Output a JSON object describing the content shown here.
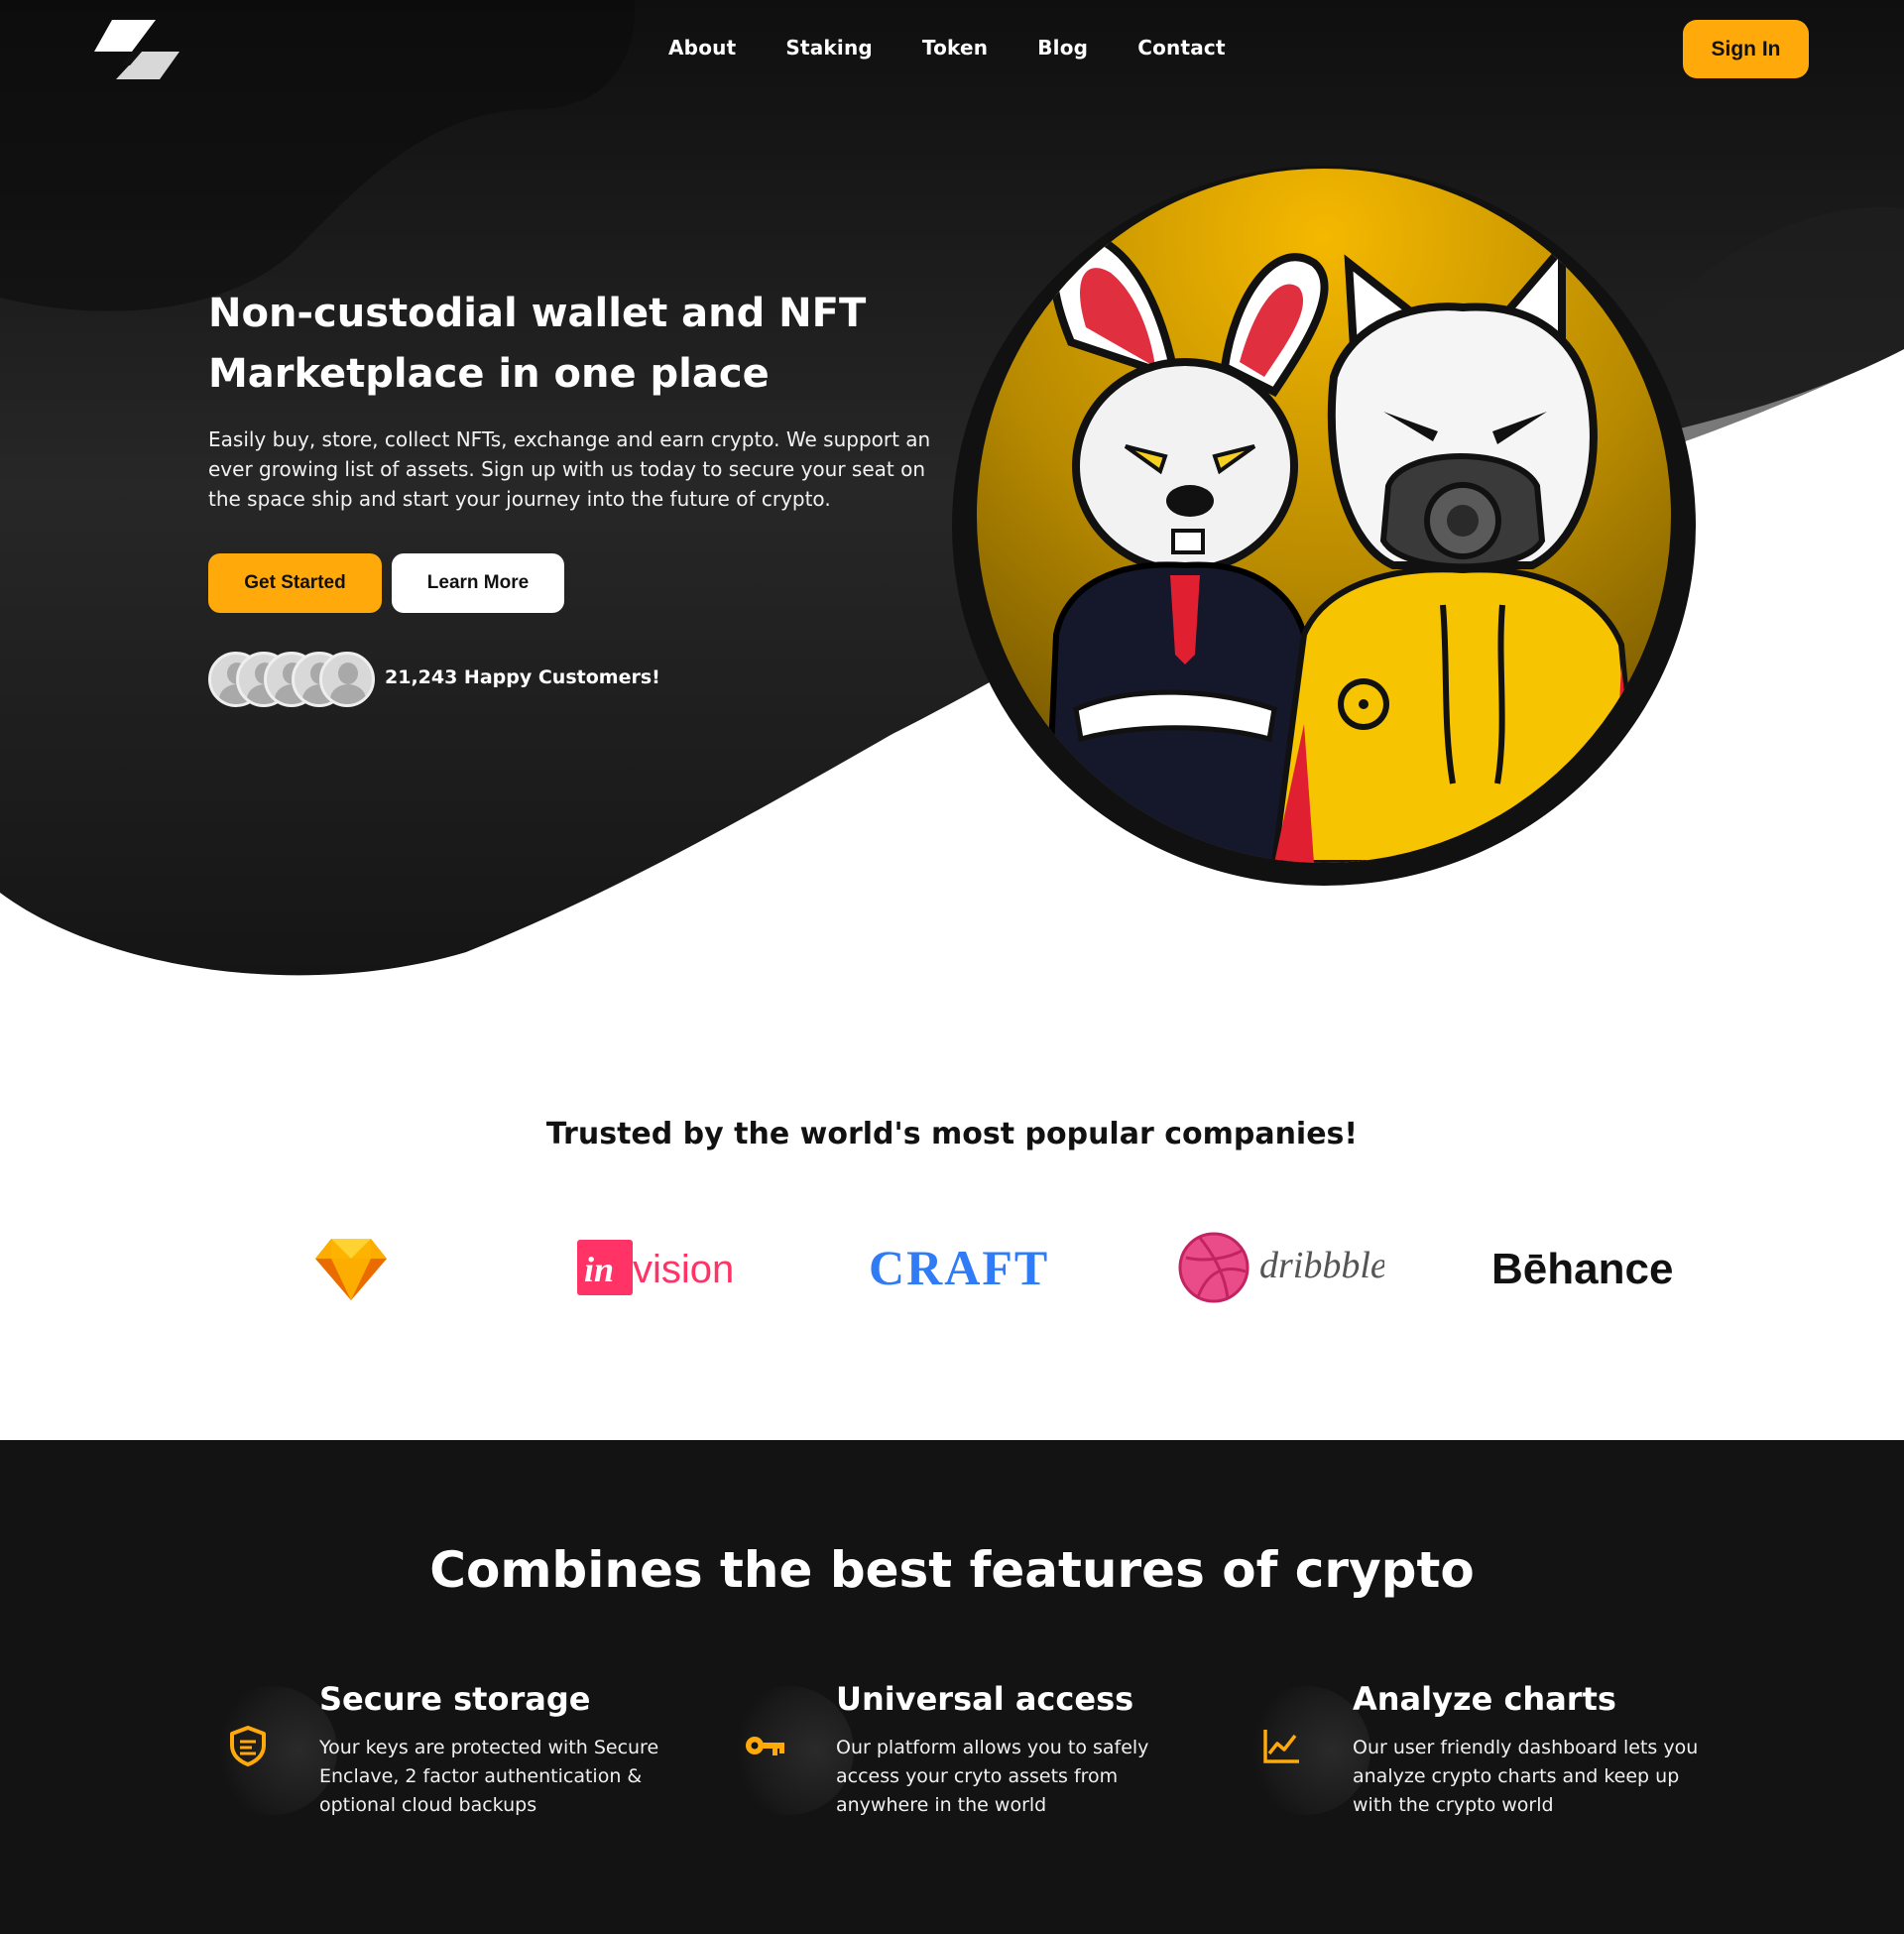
{
  "nav": {
    "items": [
      "About",
      "Staking",
      "Token",
      "Blog",
      "Contact"
    ],
    "sign_in": "Sign In"
  },
  "hero": {
    "title": "Non-custodial wallet and NFT Marketplace in one place",
    "text": "Easily buy, store, collect NFTs, exchange and earn crypto. We support an ever growing list of assets. Sign up with us today to secure your seat on the space ship and start your journey into the future of crypto.",
    "get_started": "Get Started",
    "learn_more": "Learn More",
    "happy_customers": "21,243 Happy Customers!"
  },
  "trusted": {
    "title": "Trusted by the world's most popular companies!",
    "brands": [
      "sketch-icon",
      "invision",
      "CRAFT",
      "dribbble",
      "Bēhance"
    ]
  },
  "features": {
    "title": "Combines the best features of crypto",
    "items": [
      {
        "title": "Secure storage",
        "text": "Your keys are protected with Secure Enclave, 2 factor authentication & optional cloud backups",
        "icon": "shield-icon"
      },
      {
        "title": "Universal access",
        "text": "Our platform allows you to safely access your cryto assets from anywhere in the world",
        "icon": "key-icon"
      },
      {
        "title": "Analyze charts",
        "text": "Our user friendly dashboard lets you analyze crypto charts and keep up with the crypto world",
        "icon": "chart-icon"
      }
    ]
  },
  "colors": {
    "accent": "#ffa90a",
    "dark": "#131313"
  }
}
